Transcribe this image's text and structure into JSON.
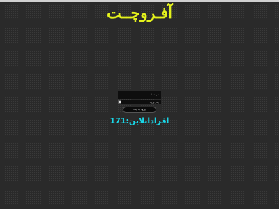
{
  "header": {
    "site_title": "آفـروچــت"
  },
  "login": {
    "username_placeholder": "نام شما",
    "password_placeholder": "رمز ورود",
    "submit_label": "ورود به چت"
  },
  "status": {
    "online_label": "افرادانلاین:",
    "online_count": "171"
  },
  "colors": {
    "background": "#2a2a2a",
    "title": "#e4f21c",
    "online_text": "#19d7e8"
  }
}
